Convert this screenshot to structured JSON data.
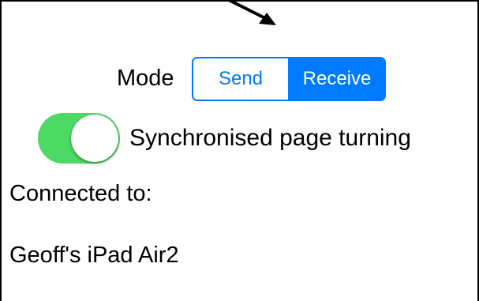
{
  "mode": {
    "label": "Mode",
    "options": [
      "Send",
      "Receive"
    ],
    "selected": "Receive"
  },
  "sync": {
    "label": "Synchronised page turning",
    "enabled": true
  },
  "connection": {
    "label": "Connected to:",
    "device": "Geoff's iPad Air2"
  },
  "colors": {
    "accent": "#007aff",
    "toggle_on": "#4cd964"
  },
  "icons": {
    "pointer": "arrow-down-right-icon"
  }
}
